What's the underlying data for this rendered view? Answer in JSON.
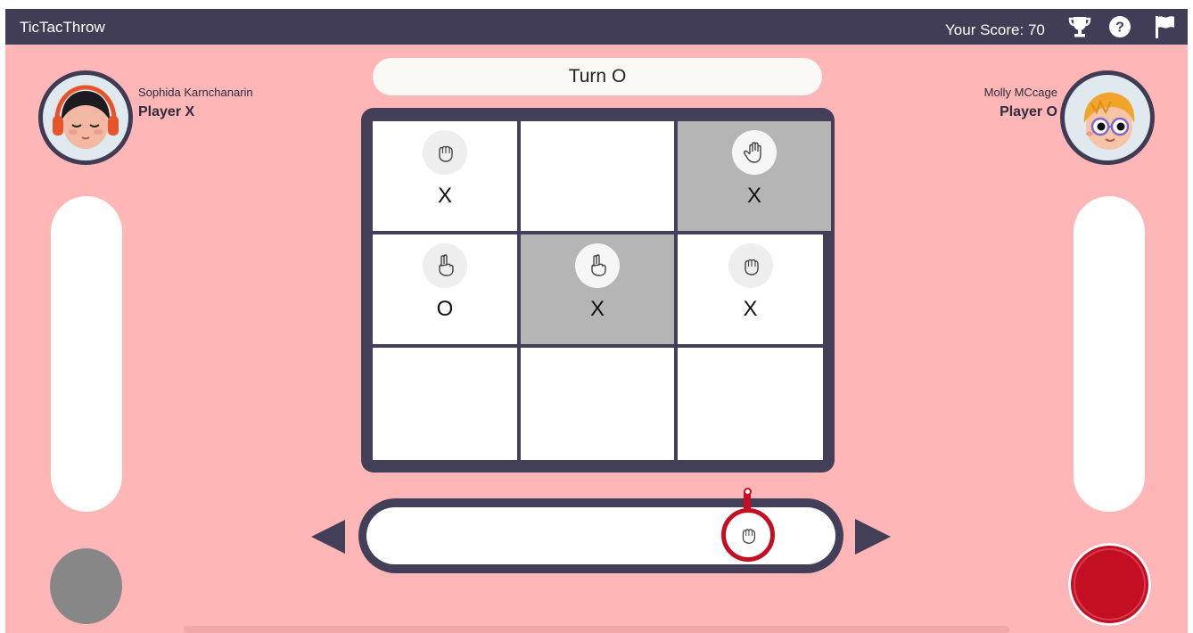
{
  "app": {
    "title": "TicTacThrow"
  },
  "header": {
    "score_label": "Your Score:",
    "score_value": "70",
    "icons": [
      "trophy-icon",
      "help-icon",
      "flag-icon"
    ]
  },
  "player_left": {
    "name": "Sophida Karnchanarin",
    "role": "Player X",
    "button_color": "#878787"
  },
  "player_right": {
    "name": "Molly MCcage",
    "role": "Player O",
    "button_color": "#c40e23"
  },
  "turn": {
    "label": "Turn O"
  },
  "board": {
    "cells": [
      {
        "mark": "X",
        "gesture": "rock",
        "highlighted": false
      },
      {
        "mark": "",
        "gesture": "",
        "highlighted": false
      },
      {
        "mark": "X",
        "gesture": "paper",
        "highlighted": true
      },
      {
        "mark": "O",
        "gesture": "scissors",
        "highlighted": false
      },
      {
        "mark": "X",
        "gesture": "scissors",
        "highlighted": true
      },
      {
        "mark": "X",
        "gesture": "rock",
        "highlighted": false
      },
      {
        "mark": "",
        "gesture": "",
        "highlighted": false
      },
      {
        "mark": "",
        "gesture": "",
        "highlighted": false
      },
      {
        "mark": "",
        "gesture": "",
        "highlighted": false
      }
    ]
  },
  "slider": {
    "gesture": "rock",
    "position": 0.81
  },
  "colors": {
    "background": "#ffb6b6",
    "header": "#413d57",
    "board": "#433f59",
    "highlight": "#b5b5b5",
    "accent": "#c40e23"
  }
}
